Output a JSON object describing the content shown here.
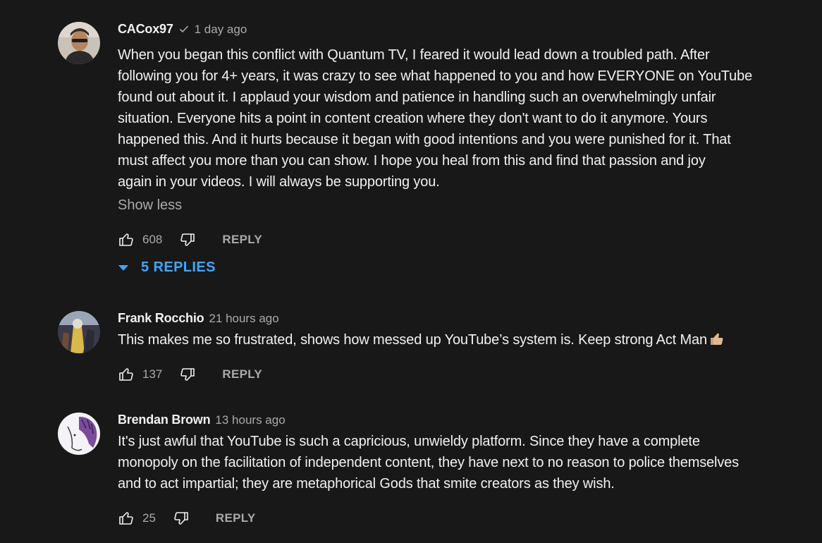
{
  "comments": [
    {
      "author": "CACox97",
      "verified": true,
      "time": "1 day ago",
      "lines": [
        "When you began this conflict with Quantum TV, I feared it would lead down a troubled path. After",
        "following you for 4+ years, it was crazy to see what happened to you and how EVERYONE on YouTube",
        "found out about it. I applaud your wisdom and patience in handling such an overwhelmingly unfair",
        "situation. Everyone hits a point in content creation where they don't want to do it anymore. Yours",
        "happened this. And it hurts because it began with good intentions and you were punished for it. That",
        "must affect you more than you can show. I hope you heal from this and find that passion and joy",
        "again in your videos. I will always be supporting you."
      ],
      "show_less": "Show less",
      "likes": "608",
      "reply_label": "REPLY",
      "replies_label": "5 REPLIES",
      "avatar_icon": "avatar-photo"
    },
    {
      "author": "Frank Rocchio",
      "time": "21 hours ago",
      "lines": [
        "This makes me so frustrated, shows how messed up YouTube’s system is. Keep strong Act Man"
      ],
      "emoji": "thumbs-up-emoji",
      "likes": "137",
      "reply_label": "REPLY",
      "avatar_icon": "avatar-photo"
    },
    {
      "author": "Brendan Brown",
      "time": "13 hours ago",
      "lines": [
        "It's just awful that YouTube is such a capricious, unwieldy platform. Since they have a complete",
        "monopoly on the facilitation of independent content, they have next to no reason to police themselves",
        "and to act impartial; they are metaphorical Gods that smite creators as they wish."
      ],
      "likes": "25",
      "reply_label": "REPLY",
      "avatar_icon": "avatar-drawing"
    }
  ],
  "colors": {
    "background": "#181818",
    "text": "#f1f1f1",
    "secondary": "#aaaaaa",
    "link_blue": "#3ea6ff"
  }
}
